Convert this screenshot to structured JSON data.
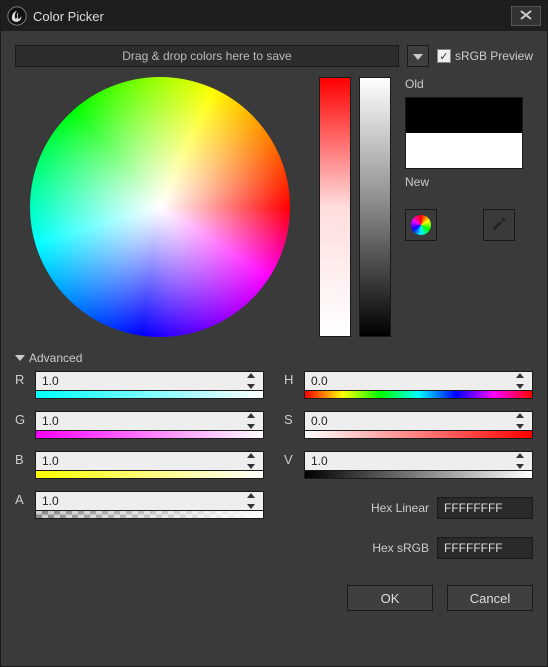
{
  "window": {
    "title": "Color Picker"
  },
  "save_bar": {
    "placeholder": "Drag & drop colors here to save"
  },
  "srgb": {
    "label": "sRGB Preview",
    "checked": true
  },
  "swatch": {
    "old_label": "Old",
    "new_label": "New"
  },
  "advanced": {
    "label": "Advanced"
  },
  "channels": {
    "R": {
      "label": "R",
      "value": "1.0"
    },
    "G": {
      "label": "G",
      "value": "1.0"
    },
    "B": {
      "label": "B",
      "value": "1.0"
    },
    "A": {
      "label": "A",
      "value": "1.0"
    },
    "H": {
      "label": "H",
      "value": "0.0"
    },
    "S": {
      "label": "S",
      "value": "0.0"
    },
    "V": {
      "label": "V",
      "value": "1.0"
    }
  },
  "hex": {
    "linear_label": "Hex Linear",
    "linear_value": "FFFFFFFF",
    "srgb_label": "Hex sRGB",
    "srgb_value": "FFFFFFFF"
  },
  "buttons": {
    "ok": "OK",
    "cancel": "Cancel"
  }
}
